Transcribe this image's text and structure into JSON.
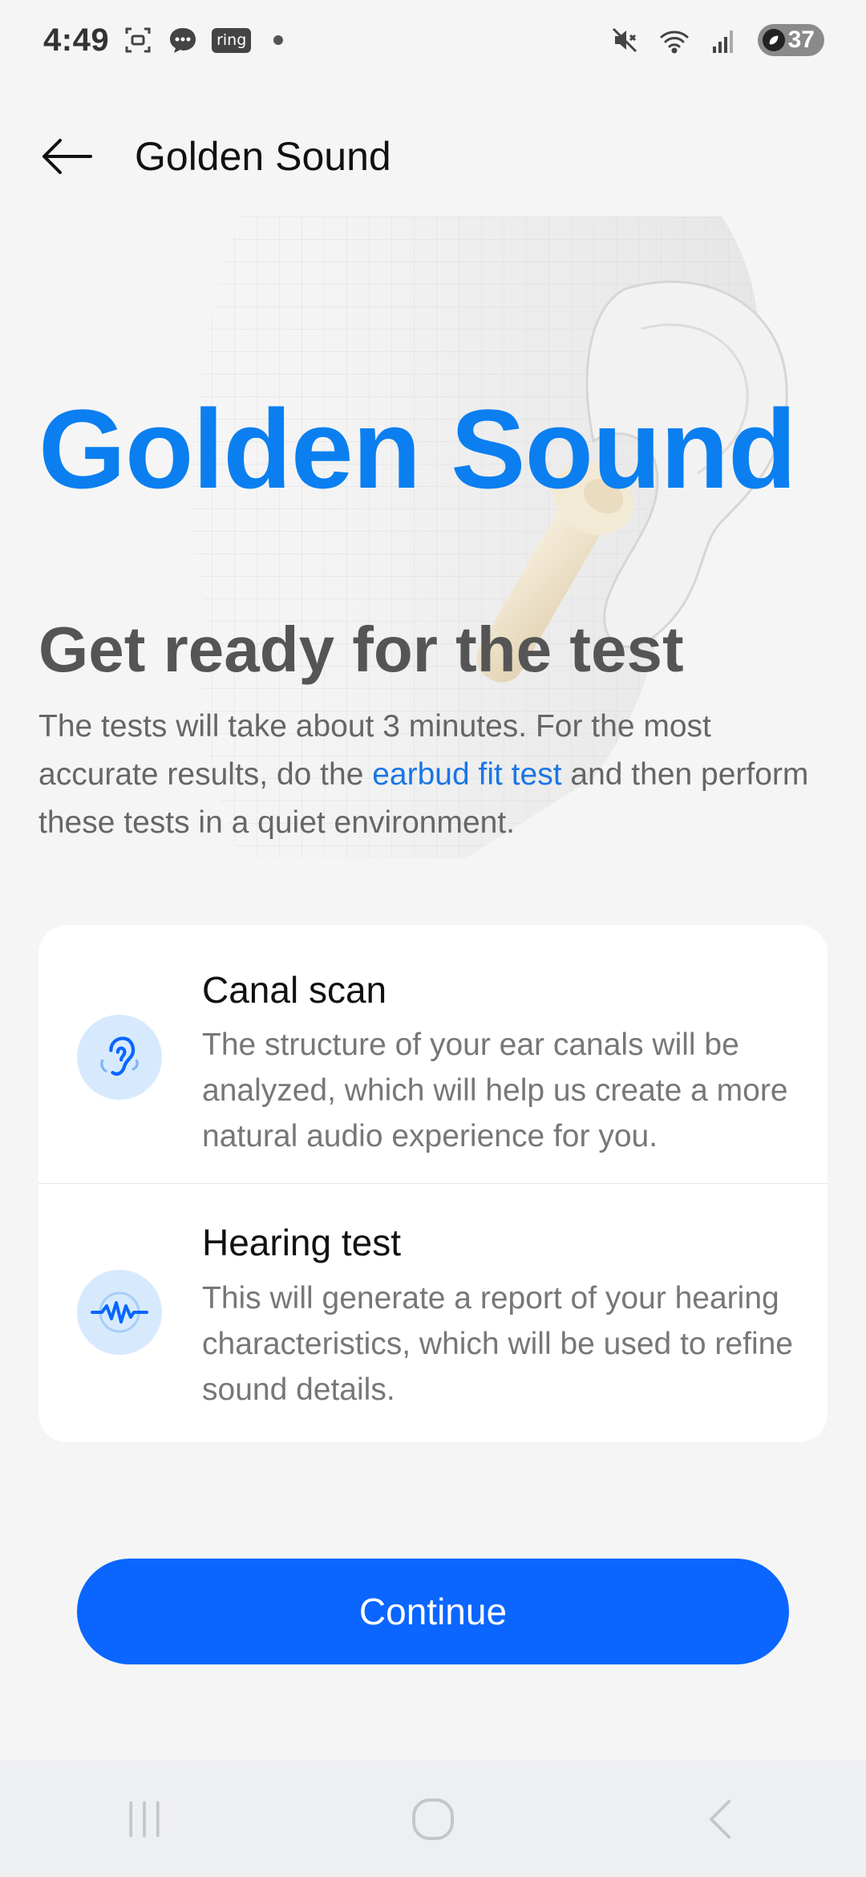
{
  "status_bar": {
    "time": "4:49",
    "ring_label": "ring",
    "battery_level": "37"
  },
  "app_bar": {
    "title": "Golden Sound"
  },
  "hero": {
    "headline": "Golden Sound",
    "subheading": "Get ready for the test",
    "description_prefix": "The tests will take about 3 minutes. For the most accurate results, do the ",
    "description_link": "earbud fit test",
    "description_suffix": " and then perform these tests in a quiet environment."
  },
  "tests": [
    {
      "title": "Canal scan",
      "description": "The structure of your ear canals will be analyzed, which will help us create a more natural audio experience for you.",
      "icon": "ear-icon"
    },
    {
      "title": "Hearing test",
      "description": "This will generate a report of your hearing characteristics, which will be used to refine sound details.",
      "icon": "sound-wave-icon"
    }
  ],
  "actions": {
    "continue_label": "Continue"
  },
  "colors": {
    "accent": "#0a66ff",
    "headline": "#0b7ff0",
    "link": "#1976e6",
    "icon_bg": "#d7eafd"
  }
}
